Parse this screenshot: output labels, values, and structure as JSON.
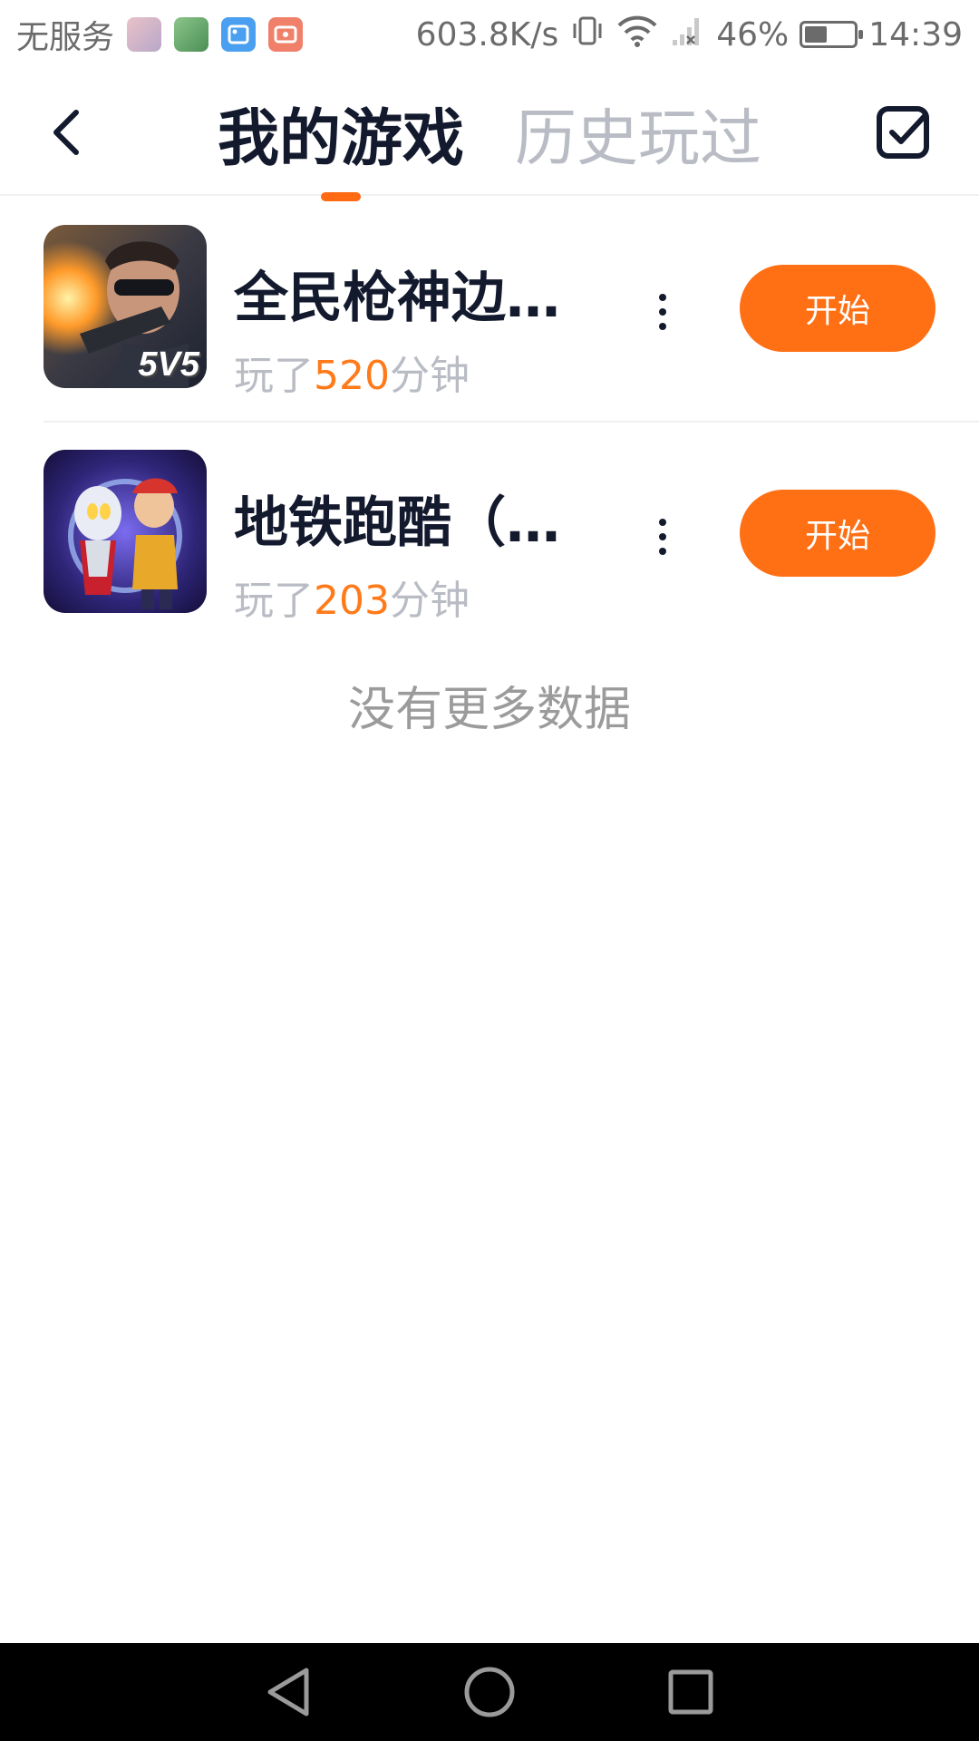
{
  "status_bar": {
    "carrier": "无服务",
    "network_speed": "603.8K/s",
    "battery_percent": "46%",
    "battery_level": 0.46,
    "time": "14:39",
    "notification_icons": [
      "photo-thumbnail-icon",
      "green-app-icon",
      "gallery-icon",
      "screen-recorder-icon"
    ]
  },
  "header": {
    "tabs": [
      {
        "label": "我的游戏",
        "active": true
      },
      {
        "label": "历史玩过",
        "active": false
      }
    ]
  },
  "games": [
    {
      "name": "全民枪神边境...",
      "playtime_prefix": "玩了",
      "playtime_minutes": "520",
      "playtime_suffix": "分钟",
      "start_label": "开始",
      "icon_text": "5V5"
    },
    {
      "name": "地铁跑酷（欧...",
      "playtime_prefix": "玩了",
      "playtime_minutes": "203",
      "playtime_suffix": "分钟",
      "start_label": "开始"
    }
  ],
  "footer_message": "没有更多数据",
  "colors": {
    "accent": "#ff6f14",
    "title_text": "#141a2e",
    "muted_text": "#b9bcc4"
  }
}
